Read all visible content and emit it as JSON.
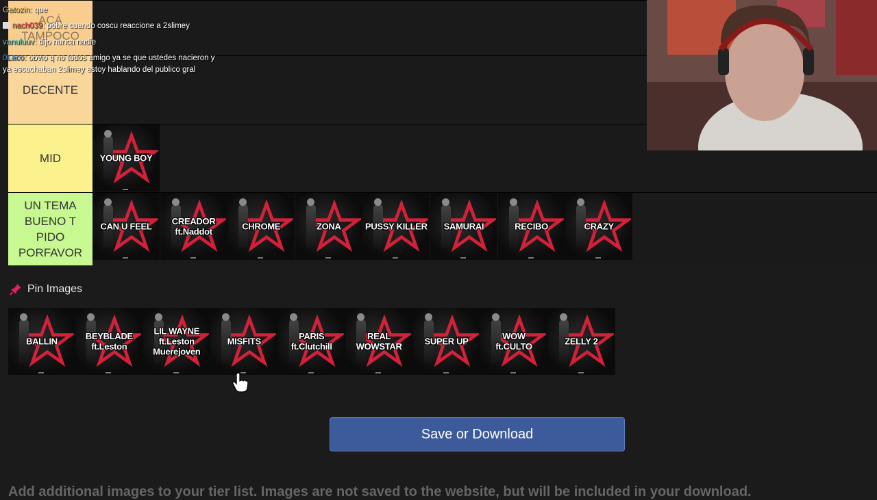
{
  "chat": [
    {
      "user": "Gatozin",
      "user_color": "#e8c774",
      "message": "que"
    },
    {
      "user": "nach039",
      "user_color": "#e04848",
      "message": "pobre cuando coscu reaccione a 2slimey"
    },
    {
      "user": "vanuluuv",
      "user_color": "#5ac8c8",
      "message": "dijo nunca nadie"
    },
    {
      "user": "0Laco",
      "user_color": "#4a90e2",
      "message": "obvio q no todos amigo ya se que ustedes nacieron y"
    },
    {
      "user": "",
      "user_color": "#ffffff",
      "message": "ya escuchaban 2slimey estoy hablando del publico gral"
    }
  ],
  "tiers": [
    {
      "label": "ACÁ TAMPOCO",
      "color": "#f9cd8e",
      "items": []
    },
    {
      "label": "DECENTE",
      "color": "#f9d79b",
      "items": []
    },
    {
      "label": "MID",
      "color": "#fbf28e",
      "items": [
        "YOUNG BOY"
      ]
    },
    {
      "label": "UN TEMA BUENO T PIDO PORFAVOR",
      "color": "#c8f891",
      "items": [
        "CAN U FEEL",
        "CREADOR ft.Naddot",
        "CHROME",
        "ZONA",
        "PUSSY KILLER",
        "SAMURAI",
        "RECIBO",
        "CRAZY"
      ]
    }
  ],
  "pin": {
    "label": "Pin Images",
    "icon": "pin-icon",
    "items": [
      "BALLIN",
      "BEYBLADE ft.Leston",
      "LIL WAYNE ft.Leston Muerejoven",
      "MISFITS",
      "PARIS ft.Clutchill",
      "REAL WOWSTAR",
      "SUPER UP",
      "WOW ft.CULTO",
      "ZELLY 2"
    ]
  },
  "save_button": "Save or Download",
  "footnote": "Add additional images to your tier list. Images are not saved to the website, but will be included in your download.",
  "colors": {
    "accent": "#3d5a9a",
    "star": "#d3213a"
  }
}
